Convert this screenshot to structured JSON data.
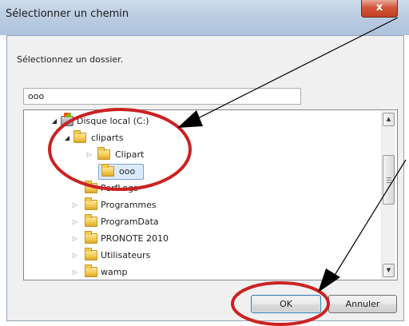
{
  "window": {
    "title": "Sélectionner un chemin",
    "close_label": "x"
  },
  "dialog": {
    "prompt": "Sélectionnez un dossier.",
    "path_value": "ooo"
  },
  "tree": {
    "items": [
      {
        "label": "Disque local (C:)",
        "level": 0,
        "expander": "expanded",
        "icon": "drive-icon"
      },
      {
        "label": "cliparts",
        "level": 1,
        "expander": "expanded",
        "icon": "folder-icon"
      },
      {
        "label": "Clipart",
        "level": 2,
        "expander": "collapsed",
        "icon": "folder-icon"
      },
      {
        "label": "ooo",
        "level": 2,
        "expander": "none",
        "icon": "folder-icon",
        "selected": true
      },
      {
        "label": "PerfLogs",
        "level": 1,
        "expander": "none",
        "icon": "folder-icon"
      },
      {
        "label": "Programmes",
        "level": 1,
        "expander": "collapsed",
        "icon": "folder-icon"
      },
      {
        "label": "ProgramData",
        "level": 1,
        "expander": "collapsed",
        "icon": "folder-icon"
      },
      {
        "label": "PRONOTE 2010",
        "level": 1,
        "expander": "collapsed",
        "icon": "folder-icon"
      },
      {
        "label": "Utilisateurs",
        "level": 1,
        "expander": "collapsed",
        "icon": "folder-icon"
      },
      {
        "label": "wamp",
        "level": 1,
        "expander": "collapsed",
        "icon": "folder-icon"
      }
    ]
  },
  "buttons": {
    "ok_label": "OK",
    "cancel_label": "Annuler"
  },
  "colors": {
    "annotation": "#cc2222",
    "selection": "#dcebfc"
  }
}
